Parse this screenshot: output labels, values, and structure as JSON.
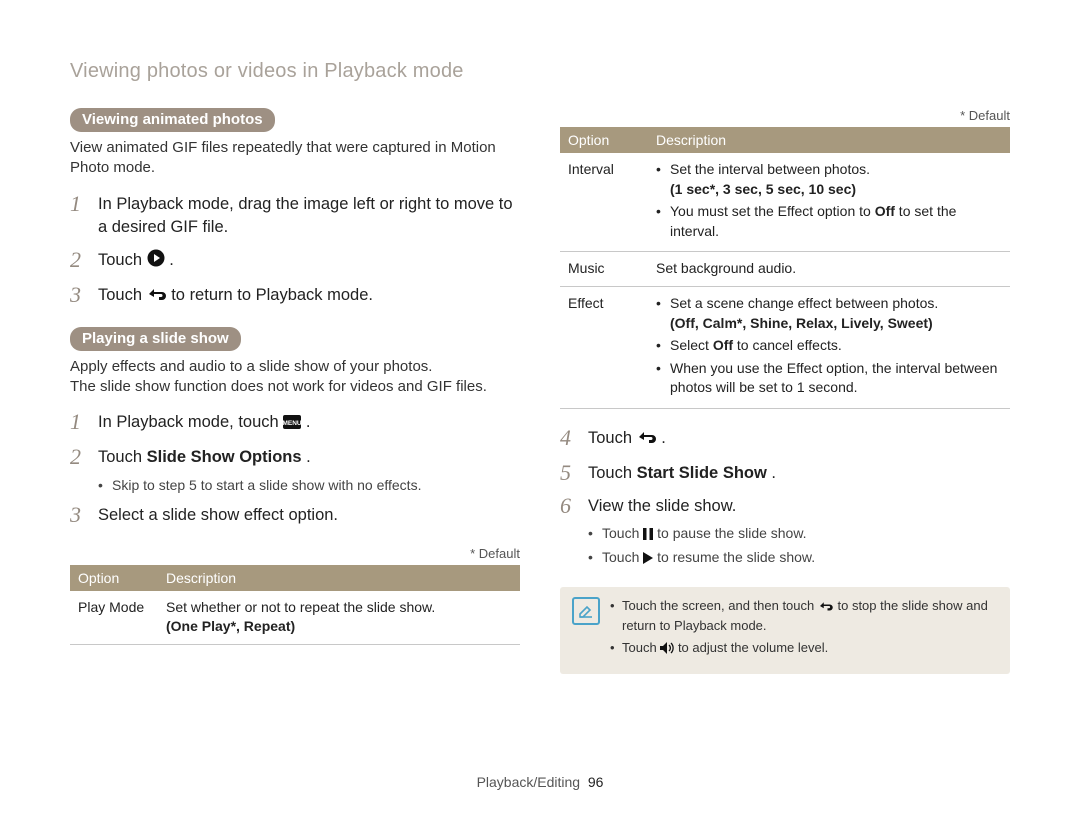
{
  "breadcrumb": "Viewing photos or videos in Playback mode",
  "left": {
    "heading1": "Viewing animated photos",
    "intro1": "View animated GIF files repeatedly that were captured in Motion Photo mode.",
    "steps1": {
      "s1": "In Playback mode, drag the image left or right to move to a desired GIF file.",
      "s2_pre": "Touch ",
      "s2_post": ".",
      "s3_pre": "Touch ",
      "s3_post": " to return to Playback mode."
    },
    "heading2": "Playing a slide show",
    "intro2a": "Apply effects and audio to a slide show of your photos.",
    "intro2b": "The slide show function does not work for videos and GIF files.",
    "steps2": {
      "s1_pre": "In Playback mode, touch ",
      "s1_post": " .",
      "s2_pre": "Touch ",
      "s2_bold": "Slide Show Options",
      "s2_post": ".",
      "s2_sub": "Skip to step 5 to start a slide show with no effects.",
      "s3": "Select a slide show effect option."
    },
    "default_note": "* Default",
    "table1": {
      "h_option": "Option",
      "h_desc": "Description",
      "r1_opt": "Play Mode",
      "r1_desc": "Set whether or not to repeat the slide show.",
      "r1_vals": "(One Play*, Repeat)"
    }
  },
  "right": {
    "default_note": "* Default",
    "table2": {
      "h_option": "Option",
      "h_desc": "Description",
      "r1_opt": "Interval",
      "r1_li1": "Set the interval between photos.",
      "r1_vals": "(1 sec*, 3 sec, 5 sec, 10 sec)",
      "r1_li2_pre": "You must set the Effect option to ",
      "r1_li2_bold": "Off",
      "r1_li2_post": " to set the interval.",
      "r2_opt": "Music",
      "r2_desc": "Set background audio.",
      "r3_opt": "Effect",
      "r3_li1": "Set a scene change effect between photos.",
      "r3_vals": "(Off, Calm*, Shine, Relax, Lively, Sweet)",
      "r3_li2_pre": "Select ",
      "r3_li2_bold": "Off",
      "r3_li2_post": " to cancel effects.",
      "r3_li3": "When you use the Effect option, the interval between photos will be set to 1 second."
    },
    "steps3": {
      "s4_pre": "Touch ",
      "s4_post": ".",
      "s5_pre": "Touch ",
      "s5_bold": "Start Slide Show",
      "s5_post": ".",
      "s6": "View the slide show.",
      "s6_sub1_pre": "Touch ",
      "s6_sub1_post": " to pause the slide show.",
      "s6_sub2_pre": "Touch ",
      "s6_sub2_post": " to resume the slide show."
    },
    "note": {
      "li1_pre": "Touch the screen, and then touch ",
      "li1_post": " to stop the slide show and return to Playback mode.",
      "li2_pre": "Touch ",
      "li2_post": " to adjust the volume level."
    }
  },
  "footer": {
    "section": "Playback/Editing",
    "page": "96"
  }
}
